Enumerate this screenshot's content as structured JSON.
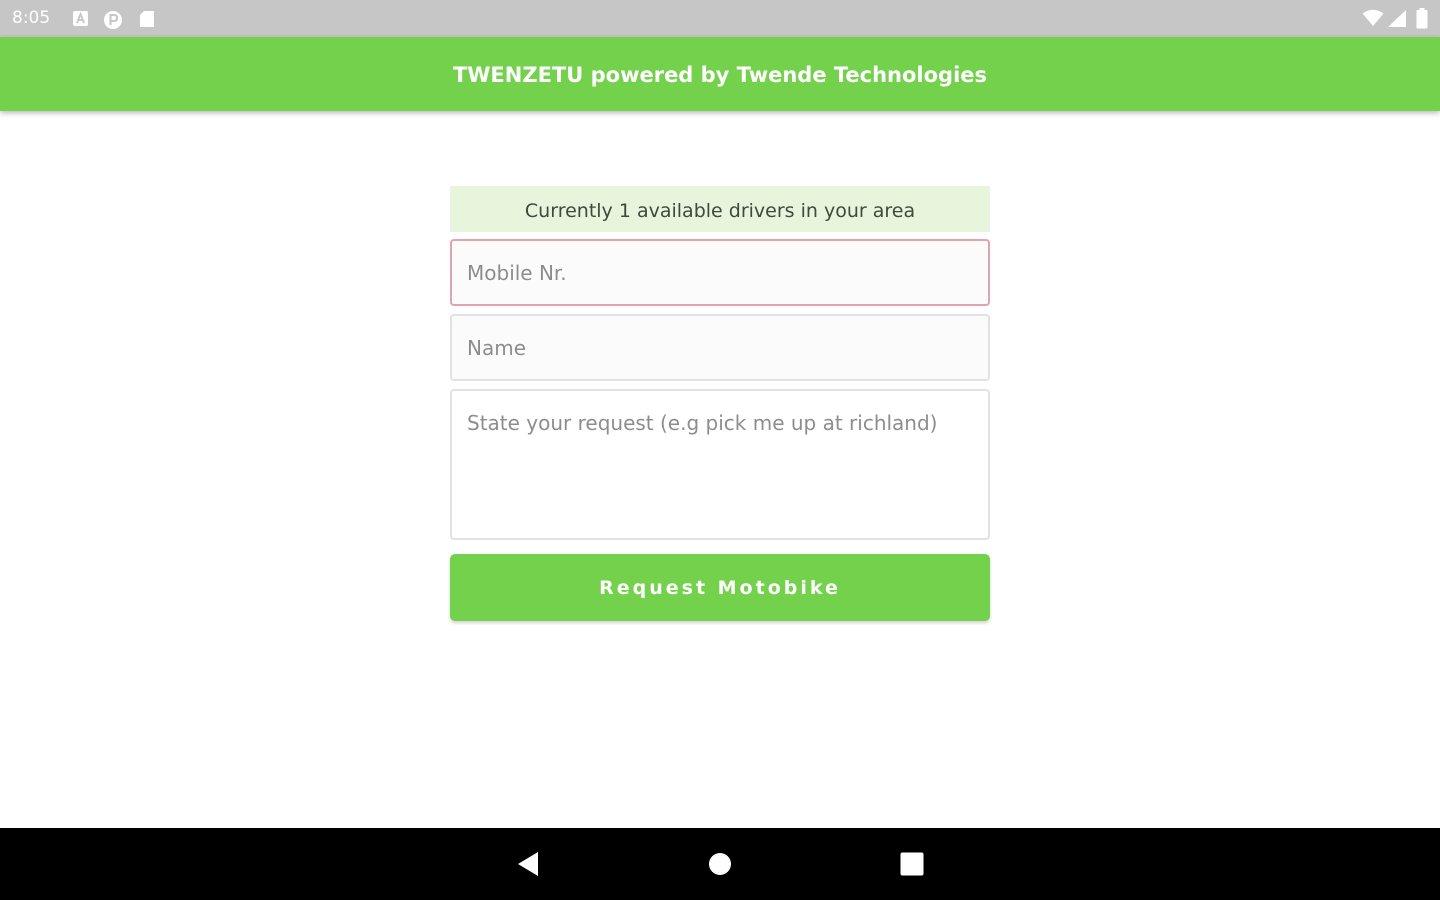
{
  "status_bar": {
    "time": "8:05",
    "left_icons": [
      "notification-a-icon",
      "notification-p-icon",
      "sd-card-icon"
    ],
    "right_icons": [
      "wifi-icon",
      "signal-icon",
      "battery-icon"
    ],
    "icon_color": "#ffffff",
    "background": "#c6c6c6"
  },
  "app_bar": {
    "title": "TWENZETU powered by Twende Technologies",
    "color": "#74d14c"
  },
  "form": {
    "drivers_notice": "Currently 1 available drivers in your area",
    "mobile": {
      "placeholder": "Mobile Nr.",
      "value": ""
    },
    "name": {
      "placeholder": "Name",
      "value": ""
    },
    "request": {
      "placeholder": "State your request (e.g pick me up at richland)",
      "value": ""
    },
    "submit_label": "Request Motobike"
  },
  "nav_bar": {
    "buttons": [
      "back-icon",
      "home-icon",
      "recents-icon"
    ]
  }
}
